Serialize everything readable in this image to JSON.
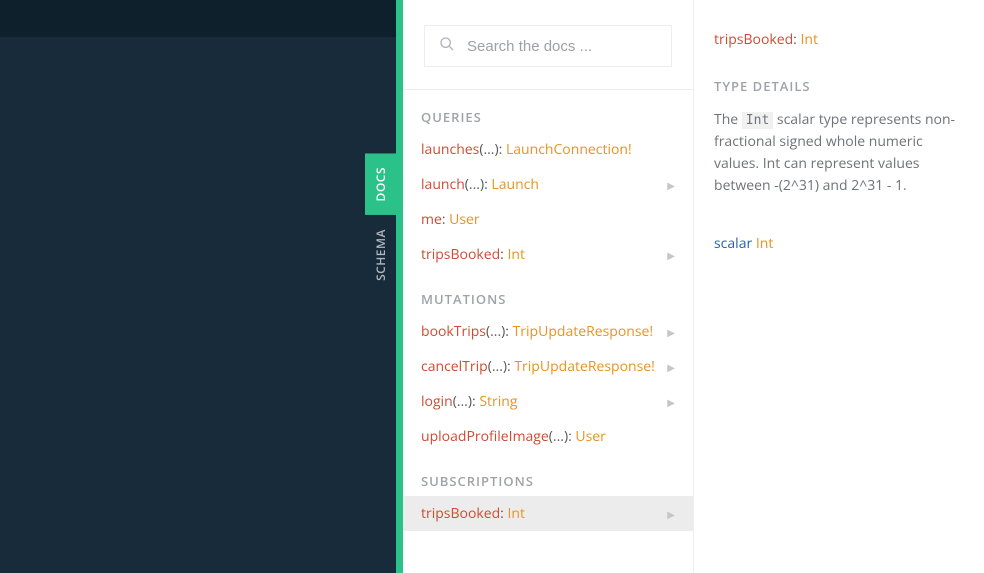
{
  "tabs": {
    "docs": "DOCS",
    "schema": "SCHEMA"
  },
  "search": {
    "placeholder": "Search the docs ..."
  },
  "sections": {
    "queries": {
      "label": "QUERIES",
      "items": [
        {
          "name": "launches",
          "args": "(...)",
          "sep": ": ",
          "type": "LaunchConnection!",
          "chevron": false
        },
        {
          "name": "launch",
          "args": "(...)",
          "sep": ": ",
          "type": "Launch",
          "chevron": true
        },
        {
          "name": "me",
          "args": "",
          "sep": ": ",
          "type": "User",
          "chevron": false
        },
        {
          "name": "tripsBooked",
          "args": "",
          "sep": ": ",
          "type": "Int",
          "chevron": true
        }
      ]
    },
    "mutations": {
      "label": "MUTATIONS",
      "items": [
        {
          "name": "bookTrips",
          "args": "(...)",
          "sep": ": ",
          "type": "TripUpdateResponse!",
          "chevron": true
        },
        {
          "name": "cancelTrip",
          "args": "(...)",
          "sep": ": ",
          "type": "TripUpdateResponse!",
          "chevron": true
        },
        {
          "name": "login",
          "args": "(...)",
          "sep": ": ",
          "type": "String",
          "chevron": true
        },
        {
          "name": "uploadProfileImage",
          "args": "(...)",
          "sep": ": ",
          "type": "User",
          "chevron": false
        }
      ]
    },
    "subscriptions": {
      "label": "SUBSCRIPTIONS",
      "items": [
        {
          "name": "tripsBooked",
          "args": "",
          "sep": ": ",
          "type": "Int",
          "chevron": true,
          "selected": true
        }
      ]
    }
  },
  "detail": {
    "field_name": "tripsBooked",
    "field_sep": ": ",
    "field_type": "Int",
    "type_details_label": "TYPE DETAILS",
    "desc_prefix": "The ",
    "desc_code": "Int",
    "desc_suffix": " scalar type represents non-fractional signed whole numeric values. Int can represent values between -(2^31) and 2^31 - 1.",
    "scalar_keyword": "scalar ",
    "scalar_type": "Int"
  },
  "glyphs": {
    "chevron": "▶"
  }
}
